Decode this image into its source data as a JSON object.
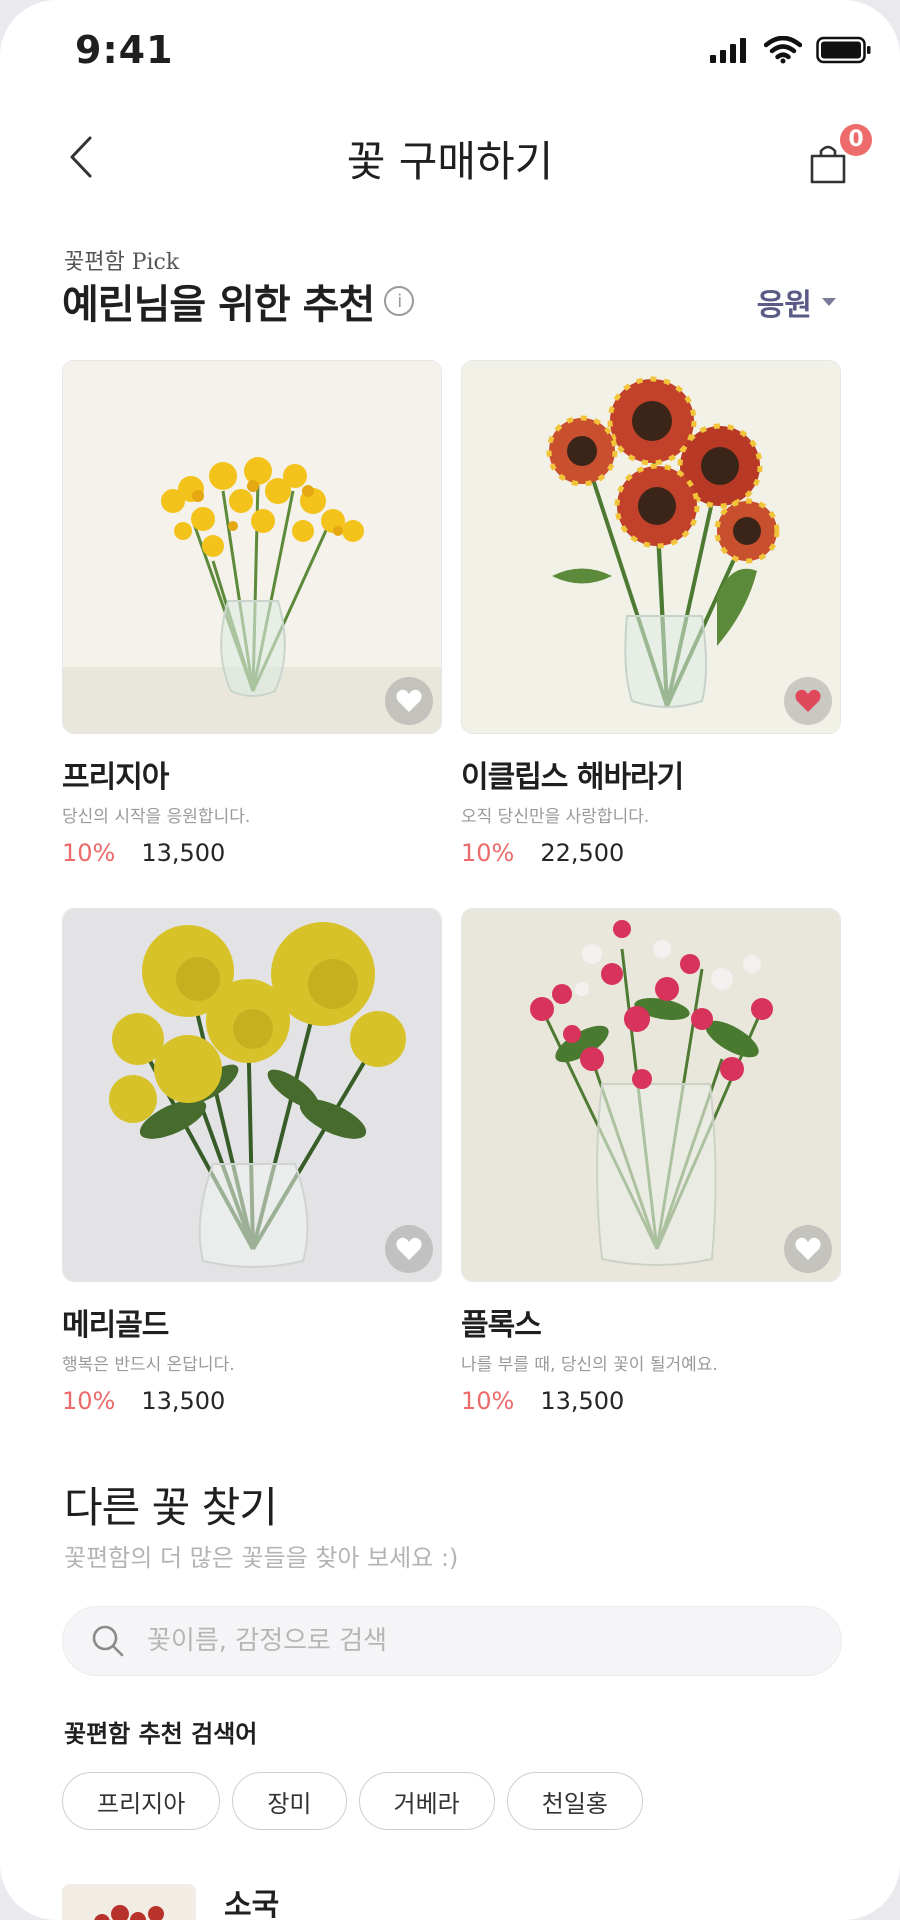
{
  "status_bar": {
    "time": "9:41",
    "icons": [
      "signal-icon",
      "wifi-icon",
      "battery-icon"
    ]
  },
  "nav": {
    "title": "꽃 구매하기",
    "cart_count": "0",
    "back_icon": "chevron-left-icon",
    "cart_icon": "shopping-bag-icon"
  },
  "pick": {
    "small_label": "꽃편함 Pick",
    "title": "예린님을 위한 추천",
    "info_icon": "i",
    "filter_label": "응원"
  },
  "products": [
    {
      "name": "프리지아",
      "desc": "당신의 시작을 응원합니다.",
      "discount": "10%",
      "price": "13,500",
      "liked": false
    },
    {
      "name": "이클립스 해바라기",
      "desc": "오직 당신만을 사랑합니다.",
      "discount": "10%",
      "price": "22,500",
      "liked": true
    },
    {
      "name": "메리골드",
      "desc": "행복은 반드시 온답니다.",
      "discount": "10%",
      "price": "13,500",
      "liked": false
    },
    {
      "name": "플록스",
      "desc": "나를 부를 때, 당신의 꽃이 될거예요.",
      "discount": "10%",
      "price": "13,500",
      "liked": false
    }
  ],
  "other": {
    "title": "다른 꽃 찾기",
    "subtitle": "꽃편함의 더 많은 꽃들을 찾아 보세요 :)",
    "search_placeholder": "꽃이름, 감정으로 검색",
    "search_value": "",
    "rec_label": "꽃편함 추천 검색어",
    "chips": [
      "프리지아",
      "장미",
      "거베라",
      "천일홍"
    ]
  },
  "list": [
    {
      "name": "소국"
    }
  ],
  "colors": {
    "accent_red": "#ec6a6a",
    "filter_text": "#5a5a86",
    "badge": "#ee6b6b"
  }
}
